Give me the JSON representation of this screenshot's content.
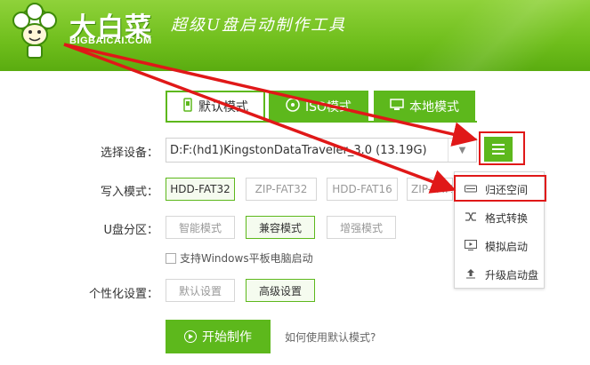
{
  "header": {
    "brand_name": "大白菜",
    "brand_domain": "BIGBAICAI.COM",
    "slogan": "超级U盘启动制作工具"
  },
  "tabs": [
    {
      "label": "默认模式",
      "icon": "usb-drive-icon",
      "active": true
    },
    {
      "label": "ISO模式",
      "icon": "disc-icon",
      "active": false
    },
    {
      "label": "本地模式",
      "icon": "computer-icon",
      "active": false
    }
  ],
  "device": {
    "label": "选择设备：",
    "value": "D:F:(hd1)KingstonDataTraveler_3.0 (13.19G)"
  },
  "write_mode": {
    "label": "写入模式：",
    "options": [
      "HDD-FAT32",
      "ZIP-FAT32",
      "HDD-FAT16",
      "ZIP-FAT16"
    ],
    "selected": "HDD-FAT32"
  },
  "partition": {
    "label": "U盘分区：",
    "options": [
      "智能模式",
      "兼容模式",
      "增强模式"
    ],
    "selected": "兼容模式"
  },
  "tablet_support": {
    "label": "支持Windows平板电脑启动",
    "checked": false
  },
  "personalize": {
    "label": "个性化设置：",
    "options": [
      "默认设置",
      "高级设置"
    ],
    "selected": "高级设置"
  },
  "start_button": {
    "label": "开始制作"
  },
  "help_link": {
    "label": "如何使用默认模式?"
  },
  "dropdown_menu": {
    "items": [
      {
        "label": "归还空间",
        "icon": "drive-icon"
      },
      {
        "label": "格式转换",
        "icon": "shuffle-icon"
      },
      {
        "label": "模拟启动",
        "icon": "monitor-play-icon"
      },
      {
        "label": "升级启动盘",
        "icon": "upload-icon"
      }
    ]
  },
  "colors": {
    "brand_green": "#5db81c",
    "annotation_red": "#e01818"
  }
}
